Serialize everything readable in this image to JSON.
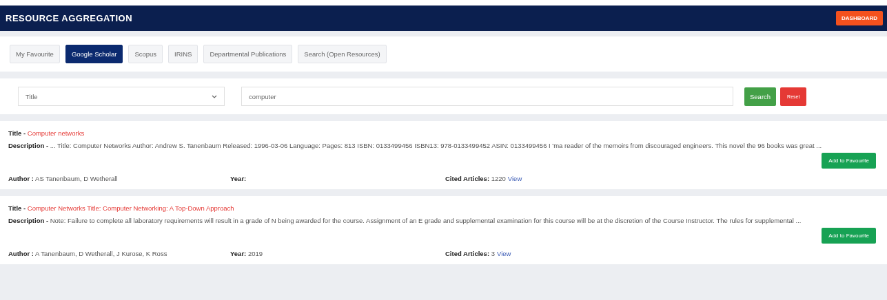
{
  "navbar": {
    "title": "RESOURCE AGGREGATION",
    "button": "DASHBOARD"
  },
  "tabs": [
    {
      "label": "My Favourite",
      "selected": false
    },
    {
      "label": "Google Scholar",
      "selected": true
    },
    {
      "label": "Scopus",
      "selected": false
    },
    {
      "label": "IRINS",
      "selected": false
    },
    {
      "label": "Departmental Publications",
      "selected": false
    },
    {
      "label": "Search (Open Resources)",
      "selected": false
    }
  ],
  "search": {
    "field": "Title",
    "query": "computer",
    "search_button": "Search",
    "reset_button": "Reset"
  },
  "results": [
    {
      "title_label": "Title -",
      "title": "Computer networks",
      "description_label": "Description -",
      "description": "... Title: Computer Networks Author: Andrew S. Tanenbaum Released: 1996-03-06 Language: Pages: 813 ISBN: 0133499456 ISBN13: 978-0133499452 ASIN: 0133499456 I 'ma reader of the memoirs from discouraged engineers. This novel the 96 books was great ...",
      "button": "Add to Favourite",
      "author_label": "Author :",
      "author": "AS Tanenbaum, D Wetherall",
      "year_label": "Year:",
      "cited_label": "Cited Articles:",
      "cited": "1220",
      "link": "View"
    },
    {
      "title_label": "Title -",
      "title": "Computer Networks Title: Computer Networking: A Top-Down Approach",
      "description_label": "Description -",
      "description": "Note: Failure to complete all laboratory requirements will result in a grade of N being awarded for the course. Assignment of an E grade and supplemental examination for this course will be at the discretion of the Course Instructor. The rules for supplemental ...",
      "button": "Add to Favourite",
      "author_label": "Author :",
      "author": "A Tanenbaum, D Wetherall, J Kurose, K Ross",
      "year_label": "Year:",
      "year": "2019",
      "cited_label": "Cited Articles:",
      "cited": "3",
      "link": "View"
    }
  ]
}
